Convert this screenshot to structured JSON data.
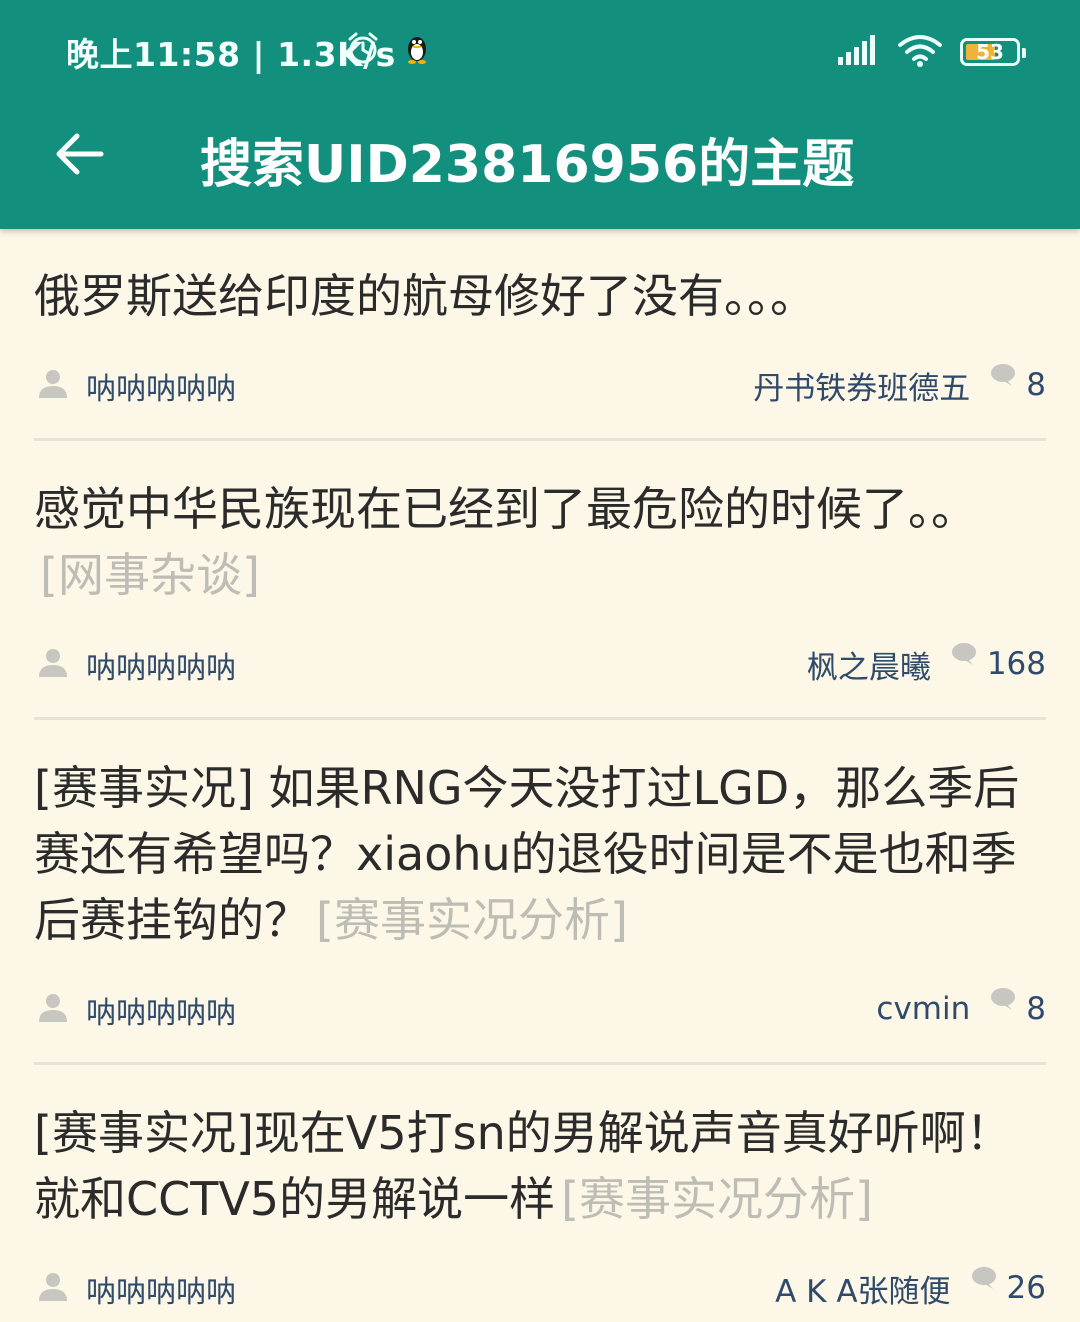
{
  "status_bar": {
    "time_speed": "晚上11:58 | 1.3K/s",
    "battery_level": "53",
    "icons": [
      "alarm-icon",
      "qq-penguin-icon",
      "signal-icon",
      "wifi-icon",
      "battery-icon"
    ]
  },
  "toolbar": {
    "title": "搜索UID23816956的主题",
    "back_icon": "arrow-left-icon"
  },
  "colors": {
    "appbar": "#138f7e",
    "background": "#fdf7e7",
    "title_text": "#2b2b2b",
    "tag_text": "#bdbdb5",
    "meta_text": "#2f4a6a"
  },
  "threads": [
    {
      "title": "俄罗斯送给印度的航母修好了没有。。。",
      "tag": "",
      "author": "呐呐呐呐呐",
      "last_reply": "丹书铁券班德五",
      "replies": "8"
    },
    {
      "title": "感觉中华民族现在已经到了最危险的时候了。。",
      "tag": "[网事杂谈]",
      "author": "呐呐呐呐呐",
      "last_reply": "枫之晨曦",
      "replies": "168"
    },
    {
      "title": "[赛事实况] 如果RNG今天没打过LGD，那么季后赛还有希望吗？xiaohu的退役时间是不是也和季后赛挂钩的？",
      "tag": "[赛事实况分析]",
      "author": "呐呐呐呐呐",
      "last_reply": "cvmin",
      "replies": "8"
    },
    {
      "title": "[赛事实况]现在V5打sn的男解说声音真好听啊！就和CCTV5的男解说一样",
      "tag": "[赛事实况分析]",
      "author": "呐呐呐呐呐",
      "last_reply": "A K A张随便",
      "replies": "26"
    }
  ]
}
